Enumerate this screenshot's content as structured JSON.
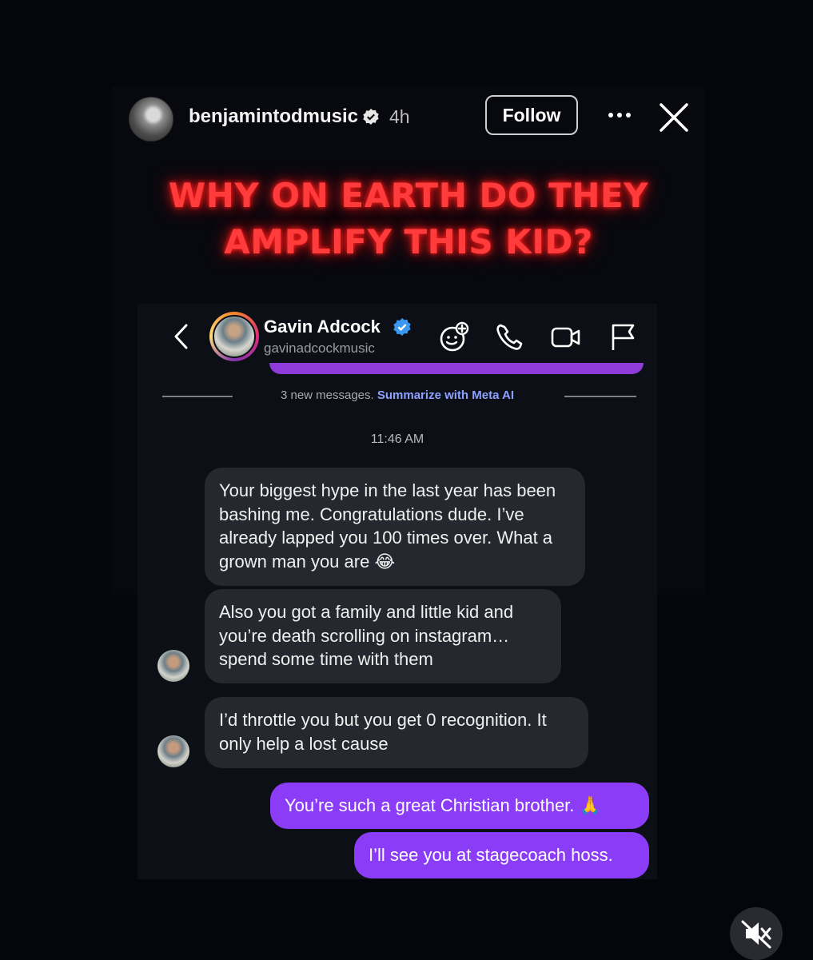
{
  "story": {
    "username": "benjamintodmusic",
    "time_ago": "4h",
    "follow_label": "Follow",
    "headline_line1": "WHY ON EARTH DO THEY",
    "headline_line2": "AMPLIFY THIS KID?",
    "headline_color": "#ff3b3b"
  },
  "dm": {
    "contact_name": "Gavin Adcock",
    "contact_handle": "gavinadcockmusic",
    "new_messages_text": "3 new messages.",
    "summarize_link": "Summarize with Meta AI",
    "timestamp": "11:46 AM",
    "messages": [
      {
        "direction": "incoming",
        "text": "Your biggest hype in the last year has been bashing me. Congratulations dude. I’ve already lapped you 100 times over. What a grown man you are",
        "emoji": "😂"
      },
      {
        "direction": "incoming",
        "text": "Also you got a family and little kid and you’re death scrolling on instagram… spend some time with them"
      },
      {
        "direction": "incoming",
        "text": "I’d throttle you but you get 0 recognition. It only help a lost cause"
      },
      {
        "direction": "outgoing",
        "text": "You’re such a great Christian brother.",
        "emoji": "🙏"
      },
      {
        "direction": "outgoing",
        "text": "I’ll see you at stagecoach hoss."
      }
    ]
  },
  "colors": {
    "outgoing_bubble": "#8b3cf7",
    "incoming_bubble": "#26282f",
    "link": "#8da2ff",
    "background": "#04060b"
  },
  "icons": [
    "more-icon",
    "close-icon",
    "back-icon",
    "ai-sticker-icon",
    "phone-icon",
    "video-icon",
    "flag-icon",
    "mute-icon"
  ]
}
